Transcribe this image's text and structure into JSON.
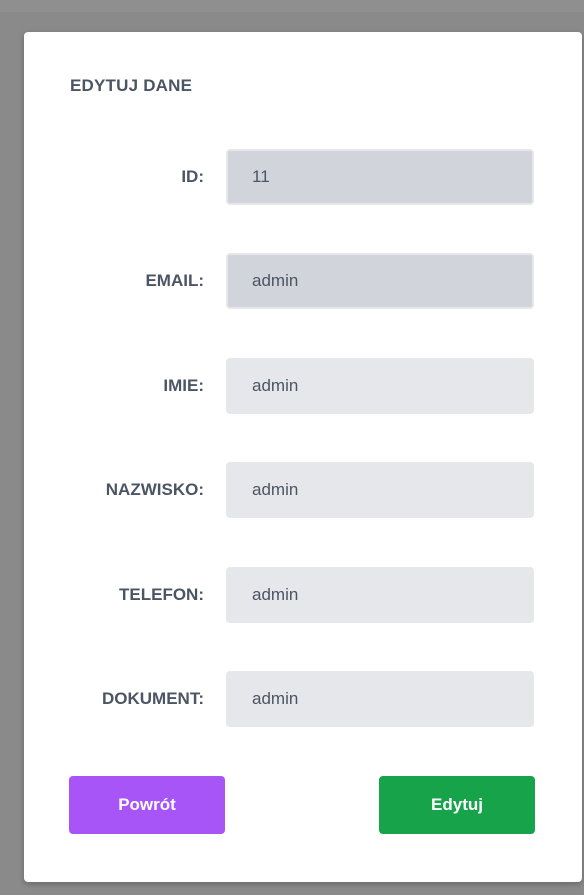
{
  "form": {
    "title": "EDYTUJ DANE",
    "fields": [
      {
        "label": "ID:",
        "value": "11",
        "disabled": true
      },
      {
        "label": "EMAIL:",
        "value": "admin",
        "disabled": true
      },
      {
        "label": "IMIE:",
        "value": "admin",
        "disabled": false
      },
      {
        "label": "NAZWISKO:",
        "value": "admin",
        "disabled": false
      },
      {
        "label": "TELEFON:",
        "value": "admin",
        "disabled": false
      },
      {
        "label": "DOKUMENT:",
        "value": "admin",
        "disabled": false
      }
    ],
    "back_label": "Powrót",
    "edit_label": "Edytuj"
  },
  "colors": {
    "back_button": "#a855f7",
    "edit_button": "#16a34a",
    "input_bg": "#e5e7eb",
    "input_disabled_bg": "#d1d5db",
    "label_text": "#4b5563"
  }
}
